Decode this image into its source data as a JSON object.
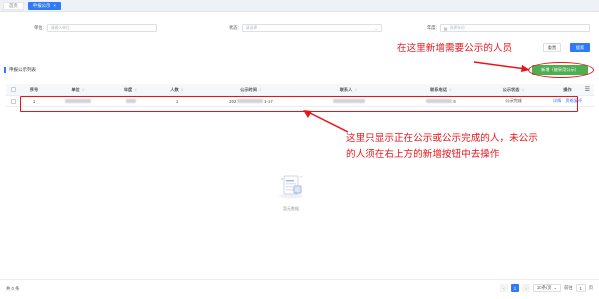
{
  "tabs": [
    {
      "label": "首页",
      "active": false
    },
    {
      "label": "申报公示",
      "active": true,
      "close": "×"
    }
  ],
  "search": {
    "unit_label": "单位:",
    "unit_placeholder": "请输入单位",
    "status_label": "状态:",
    "status_placeholder": "请选择",
    "year_label": "年度:",
    "year_placeholder": "选择年份",
    "reset_label": "重置",
    "search_label": "搜索"
  },
  "list": {
    "title": "申报公示列表",
    "add_label": "新增（被采用公示）"
  },
  "columns": [
    "序号",
    "单位",
    "年度",
    "人数",
    "公示时间",
    "联系人",
    "联系电话",
    "公示状态",
    "操作"
  ],
  "rows": [
    {
      "index": "1",
      "count": "1",
      "time_prefix": "202",
      "time_suffix": "1-17",
      "phone_suffix": "6",
      "status": "公示完成",
      "actions": [
        "详情",
        "资格复评"
      ]
    }
  ],
  "empty_text": "暂无数据",
  "annotations": {
    "note1": "在这里新增需要公示的人员",
    "note2_line1": "这里只显示正在公示或公示完成的人，未公示",
    "note2_line2": "的人须在右上方的新增按钮中去操作"
  },
  "footer": {
    "total": "共 0 条",
    "current_page": "1",
    "page_size": "10条/页",
    "goto_label": "前往",
    "goto_value": "1",
    "page_unit": "页"
  },
  "colors": {
    "primary": "#2f7bf6",
    "add_button": "#4caf50",
    "annotation": "#e8141a"
  }
}
